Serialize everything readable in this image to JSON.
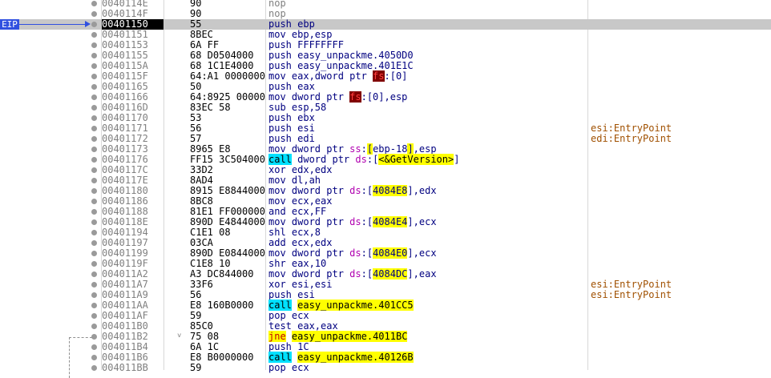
{
  "eip_label": "EIP",
  "rows": [
    {
      "addr": "0040114E",
      "bytes": "90",
      "ins": [
        {
          "t": "nop",
          "c": "dim"
        }
      ],
      "comment": ""
    },
    {
      "addr": "0040114F",
      "bytes": "90",
      "ins": [
        {
          "t": "nop",
          "c": "dim"
        }
      ],
      "comment": ""
    },
    {
      "addr": "00401150",
      "bytes": "55",
      "ins": [
        {
          "t": "push ebp"
        }
      ],
      "comment": "",
      "current": true
    },
    {
      "addr": "00401151",
      "bytes": "8BEC",
      "ins": [
        {
          "t": "mov ebp,esp"
        }
      ],
      "comment": ""
    },
    {
      "addr": "00401153",
      "bytes": "6A FF",
      "ins": [
        {
          "t": "push FFFFFFFF"
        }
      ],
      "comment": ""
    },
    {
      "addr": "00401155",
      "bytes": "68 D0504000",
      "ins": [
        {
          "t": "push easy_unpackme.4050D0"
        }
      ],
      "comment": ""
    },
    {
      "addr": "0040115A",
      "bytes": "68 1C1E4000",
      "ins": [
        {
          "t": "push easy_unpackme.401E1C"
        }
      ],
      "comment": ""
    },
    {
      "addr": "0040115F",
      "bytes": "64:A1 00000000",
      "ins": [
        {
          "t": "mov eax,dword ptr "
        },
        {
          "t": "fs",
          "c": "fs-hl"
        },
        {
          "t": ":[0]"
        }
      ],
      "comment": ""
    },
    {
      "addr": "00401165",
      "bytes": "50",
      "ins": [
        {
          "t": "push eax"
        }
      ],
      "comment": ""
    },
    {
      "addr": "00401166",
      "bytes": "64:8925 00000000",
      "ins": [
        {
          "t": "mov dword ptr "
        },
        {
          "t": "fs",
          "c": "fs-hl"
        },
        {
          "t": ":[0],esp"
        }
      ],
      "comment": ""
    },
    {
      "addr": "0040116D",
      "bytes": "83EC 58",
      "ins": [
        {
          "t": "sub esp,58"
        }
      ],
      "comment": ""
    },
    {
      "addr": "00401170",
      "bytes": "53",
      "ins": [
        {
          "t": "push ebx"
        }
      ],
      "comment": ""
    },
    {
      "addr": "00401171",
      "bytes": "56",
      "ins": [
        {
          "t": "push esi"
        }
      ],
      "comment": "esi:EntryPoint"
    },
    {
      "addr": "00401172",
      "bytes": "57",
      "ins": [
        {
          "t": "push edi"
        }
      ],
      "comment": "edi:EntryPoint"
    },
    {
      "addr": "00401173",
      "bytes": "8965 E8",
      "ins": [
        {
          "t": "mov dword ptr "
        },
        {
          "t": "ss",
          "c": "seg"
        },
        {
          "t": ":"
        },
        {
          "t": "[",
          "c": "mem-hl"
        },
        {
          "t": "ebp-18"
        },
        {
          "t": "]",
          "c": "mem-hl"
        },
        {
          "t": ",esp"
        }
      ],
      "comment": ""
    },
    {
      "addr": "00401176",
      "bytes": "FF15 3C504000",
      "ins": [
        {
          "t": "call",
          "c": "call-hl"
        },
        {
          "t": " dword ptr "
        },
        {
          "t": "ds",
          "c": "seg"
        },
        {
          "t": ":["
        },
        {
          "t": "<&GetVersion>",
          "c": "tgt-hl"
        },
        {
          "t": "]"
        }
      ],
      "comment": ""
    },
    {
      "addr": "0040117C",
      "bytes": "33D2",
      "ins": [
        {
          "t": "xor edx,edx"
        }
      ],
      "comment": ""
    },
    {
      "addr": "0040117E",
      "bytes": "8AD4",
      "ins": [
        {
          "t": "mov dl,ah"
        }
      ],
      "comment": ""
    },
    {
      "addr": "00401180",
      "bytes": "8915 E8844000",
      "ins": [
        {
          "t": "mov dword ptr "
        },
        {
          "t": "ds",
          "c": "seg"
        },
        {
          "t": ":["
        },
        {
          "t": "4084E8",
          "c": "mem-hl"
        },
        {
          "t": "],edx"
        }
      ],
      "comment": ""
    },
    {
      "addr": "00401186",
      "bytes": "8BC8",
      "ins": [
        {
          "t": "mov ecx,eax"
        }
      ],
      "comment": ""
    },
    {
      "addr": "00401188",
      "bytes": "81E1 FF000000",
      "ins": [
        {
          "t": "and ecx,FF"
        }
      ],
      "comment": ""
    },
    {
      "addr": "0040118E",
      "bytes": "890D E4844000",
      "ins": [
        {
          "t": "mov dword ptr "
        },
        {
          "t": "ds",
          "c": "seg"
        },
        {
          "t": ":["
        },
        {
          "t": "4084E4",
          "c": "mem-hl"
        },
        {
          "t": "],ecx"
        }
      ],
      "comment": ""
    },
    {
      "addr": "00401194",
      "bytes": "C1E1 08",
      "ins": [
        {
          "t": "shl ecx,8"
        }
      ],
      "comment": ""
    },
    {
      "addr": "00401197",
      "bytes": "03CA",
      "ins": [
        {
          "t": "add ecx,edx"
        }
      ],
      "comment": ""
    },
    {
      "addr": "00401199",
      "bytes": "890D E0844000",
      "ins": [
        {
          "t": "mov dword ptr "
        },
        {
          "t": "ds",
          "c": "seg"
        },
        {
          "t": ":["
        },
        {
          "t": "4084E0",
          "c": "mem-hl"
        },
        {
          "t": "],ecx"
        }
      ],
      "comment": ""
    },
    {
      "addr": "0040119F",
      "bytes": "C1E8 10",
      "ins": [
        {
          "t": "shr eax,10"
        }
      ],
      "comment": ""
    },
    {
      "addr": "004011A2",
      "bytes": "A3 DC844000",
      "ins": [
        {
          "t": "mov dword ptr "
        },
        {
          "t": "ds",
          "c": "seg"
        },
        {
          "t": ":["
        },
        {
          "t": "4084DC",
          "c": "mem-hl"
        },
        {
          "t": "],eax"
        }
      ],
      "comment": ""
    },
    {
      "addr": "004011A7",
      "bytes": "33F6",
      "ins": [
        {
          "t": "xor esi,esi"
        }
      ],
      "comment": "esi:EntryPoint"
    },
    {
      "addr": "004011A9",
      "bytes": "56",
      "ins": [
        {
          "t": "push esi"
        }
      ],
      "comment": "esi:EntryPoint"
    },
    {
      "addr": "004011AA",
      "bytes": "E8 160B0000",
      "ins": [
        {
          "t": "call",
          "c": "call-hl"
        },
        {
          "t": " "
        },
        {
          "t": "easy_unpackme.401CC5",
          "c": "tgt-hl"
        }
      ],
      "comment": ""
    },
    {
      "addr": "004011AF",
      "bytes": "59",
      "ins": [
        {
          "t": "pop ecx"
        }
      ],
      "comment": ""
    },
    {
      "addr": "004011B0",
      "bytes": "85C0",
      "ins": [
        {
          "t": "test eax,eax"
        }
      ],
      "comment": ""
    },
    {
      "addr": "004011B2",
      "bytes": "75 08",
      "ins": [
        {
          "t": "jne",
          "c": "jmp-hl"
        },
        {
          "t": " "
        },
        {
          "t": "easy_unpackme.4011BC",
          "c": "tgt-hl"
        }
      ],
      "comment": "",
      "jump": true
    },
    {
      "addr": "004011B4",
      "bytes": "6A 1C",
      "ins": [
        {
          "t": "push 1C"
        }
      ],
      "comment": ""
    },
    {
      "addr": "004011B6",
      "bytes": "E8 B0000000",
      "ins": [
        {
          "t": "call",
          "c": "call-hl"
        },
        {
          "t": " "
        },
        {
          "t": "easy_unpackme.40126B",
          "c": "tgt-hl"
        }
      ],
      "comment": ""
    },
    {
      "addr": "004011BB",
      "bytes": "59",
      "ins": [
        {
          "t": "pop ecx"
        }
      ],
      "comment": ""
    }
  ]
}
